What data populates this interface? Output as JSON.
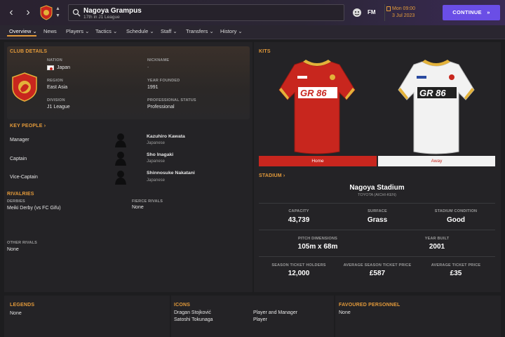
{
  "topbar": {
    "club_name": "Nagoya Grampus",
    "club_sub": "17th in J1 League",
    "fm_label": "FM",
    "time": "Mon 09:00",
    "date": "3 Jul 2023",
    "continue_label": "CONTINUE",
    "back_icon": "chevron-left-icon",
    "forward_icon": "chevron-right-icon"
  },
  "menu": {
    "items": [
      "Overview",
      "News",
      "Players",
      "Tactics",
      "Schedule",
      "Staff",
      "Transfers",
      "History"
    ]
  },
  "club_details": {
    "title": "CLUB DETAILS",
    "nation_label": "NATION",
    "nation": "Japan",
    "nickname_label": "NICKNAME",
    "nickname": "-",
    "region_label": "REGION",
    "region": "East Asia",
    "year_founded_label": "YEAR FOUNDED",
    "year_founded": "1991",
    "division_label": "DIVISION",
    "division": "J1 League",
    "status_label": "PROFESSIONAL STATUS",
    "status": "Professional"
  },
  "key_people": {
    "title": "KEY PEOPLE",
    "rows": [
      {
        "role": "Manager",
        "name": "Kazuhiro Kawata",
        "nationality": "Japanese"
      },
      {
        "role": "Captain",
        "name": "Sho Inagaki",
        "nationality": "Japanese"
      },
      {
        "role": "Vice-Captain",
        "name": "Shinnosuke Nakatani",
        "nationality": "Japanese"
      }
    ]
  },
  "rivalries": {
    "title": "RIVALRIES",
    "derbies_label": "DERBIES",
    "derbies": "Meiki Derby (vs FC Gifu)",
    "fierce_label": "FIERCE RIVALS",
    "fierce": "None",
    "other_label": "OTHER RIVALS",
    "other": "None"
  },
  "kits": {
    "title": "KITS",
    "sponsor": "GR 86",
    "home_label": "Home",
    "away_label": "Away",
    "home_color": "#c8261e",
    "away_color": "#f2f2f2"
  },
  "stadium": {
    "title": "STADIUM",
    "name": "Nagoya Stadium",
    "location": "TOYOTA (AICHI-KEN)",
    "capacity_label": "CAPACITY",
    "capacity": "43,739",
    "surface_label": "SURFACE",
    "surface": "Grass",
    "condition_label": "STADIUM CONDITION",
    "condition": "Good",
    "pitch_label": "PITCH DIMENSIONS",
    "pitch": "105m x 68m",
    "year_built_label": "YEAR BUILT",
    "year_built": "2001",
    "season_holders_label": "SEASON TICKET HOLDERS",
    "season_holders": "12,000",
    "avg_season_label": "AVERAGE SEASON TICKET PRICE",
    "avg_season": "£587",
    "avg_ticket_label": "AVERAGE TICKET PRICE",
    "avg_ticket": "£35"
  },
  "legends": {
    "title": "LEGENDS",
    "value": "None"
  },
  "icons": {
    "title": "ICONS",
    "rows": [
      {
        "name": "Dragan Stojković",
        "role": "Player and Manager"
      },
      {
        "name": "Satoshi Tokunaga",
        "role": "Player"
      }
    ]
  },
  "favoured": {
    "title": "FAVOURED PERSONNEL",
    "value": "None"
  },
  "colors": {
    "accent": "#e39a3a",
    "continue": "#6a4ee6"
  }
}
